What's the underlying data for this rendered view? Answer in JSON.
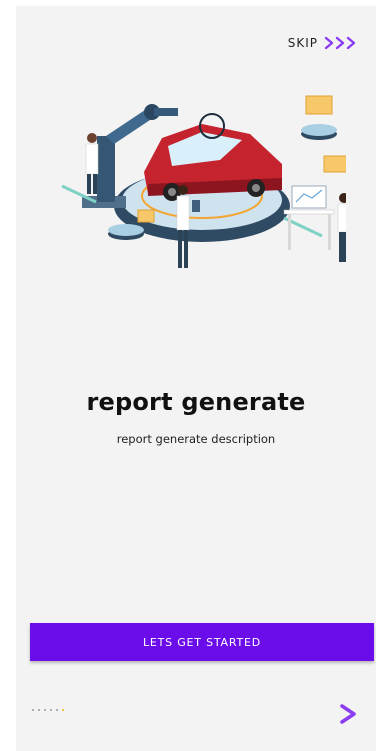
{
  "header": {
    "skip_label": "SKIP",
    "skip_icon": "triple-chevron-right-icon"
  },
  "illustration": {
    "icon": "car-factory-illustration"
  },
  "content": {
    "title": "report generate",
    "description": "report generate description"
  },
  "actions": {
    "primary_label": "LETS GET STARTED",
    "next_icon": "chevron-right-icon"
  },
  "pagination": {
    "total": 6,
    "active_index": 5
  },
  "colors": {
    "primary": "#6a0dea",
    "accent": "#f5b600",
    "background": "#f3f3f4",
    "skip_icon": "#8a3cf0"
  }
}
